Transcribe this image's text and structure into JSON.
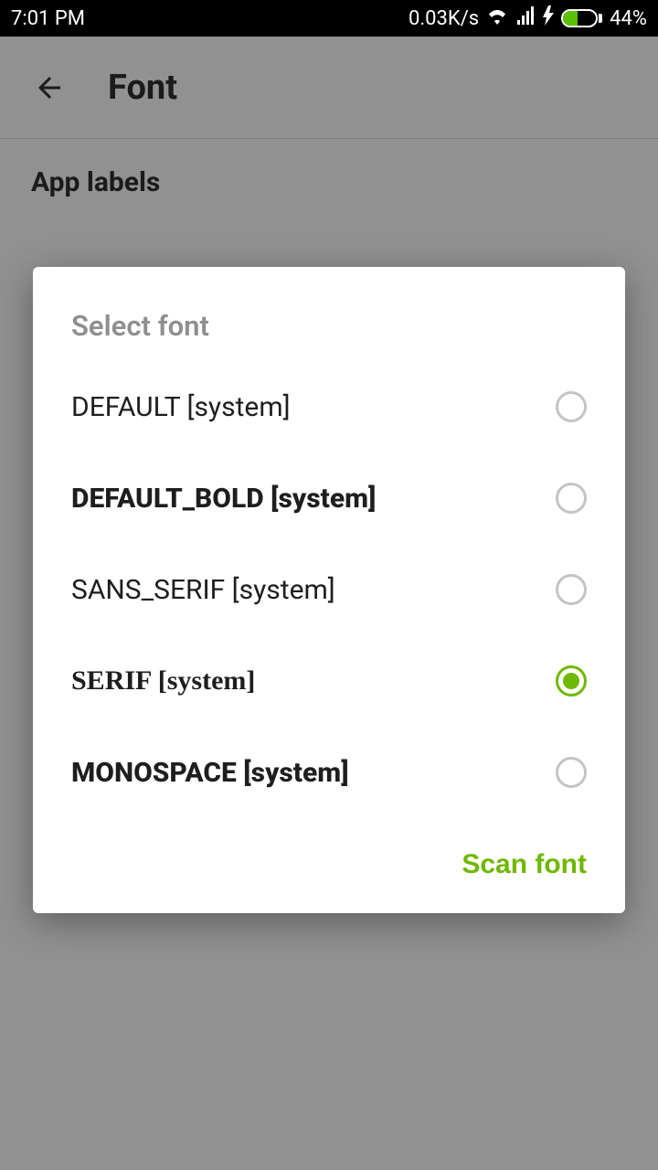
{
  "statusbar": {
    "time": "7:01 PM",
    "net_speed": "0.03K/s",
    "battery_pct": "44%"
  },
  "toolbar": {
    "title": "Font"
  },
  "section": {
    "title": "App labels"
  },
  "dialog": {
    "title": "Select font",
    "options": [
      {
        "label": "DEFAULT [system]",
        "style": "default",
        "selected": false
      },
      {
        "label": "DEFAULT_BOLD [system]",
        "style": "bold",
        "selected": false
      },
      {
        "label": "SANS_SERIF [system]",
        "style": "sans",
        "selected": false
      },
      {
        "label": "SERIF [system]",
        "style": "serif",
        "selected": true
      },
      {
        "label": "MONOSPACE [system]",
        "style": "mono",
        "selected": false
      }
    ],
    "action_label": "Scan font"
  },
  "colors": {
    "accent": "#6fb800"
  }
}
